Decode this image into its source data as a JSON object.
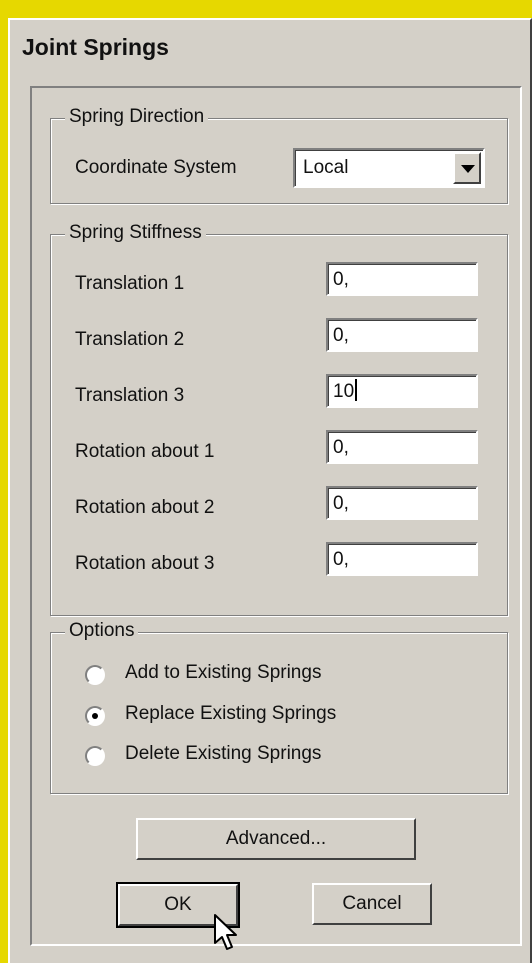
{
  "window": {
    "title": "Joint Springs"
  },
  "spring_direction": {
    "title": "Spring Direction",
    "coordinate_system_label": "Coordinate System",
    "coordinate_system_value": "Local"
  },
  "spring_stiffness": {
    "title": "Spring Stiffness",
    "rows": [
      {
        "label": "Translation 1",
        "value": "0,"
      },
      {
        "label": "Translation 2",
        "value": "0,"
      },
      {
        "label": "Translation 3",
        "value": "10"
      },
      {
        "label": "Rotation about 1",
        "value": "0,"
      },
      {
        "label": "Rotation about 2",
        "value": "0,"
      },
      {
        "label": "Rotation about 3",
        "value": "0,"
      }
    ]
  },
  "options": {
    "title": "Options",
    "items": [
      {
        "label": "Add to Existing Springs",
        "checked": false
      },
      {
        "label": "Replace Existing Springs",
        "checked": true
      },
      {
        "label": "Delete Existing Springs",
        "checked": false
      }
    ]
  },
  "buttons": {
    "advanced": "Advanced...",
    "ok": "OK",
    "cancel": "Cancel"
  },
  "colors": {
    "background": "#e6d800",
    "dialog": "#d4d0c8"
  }
}
